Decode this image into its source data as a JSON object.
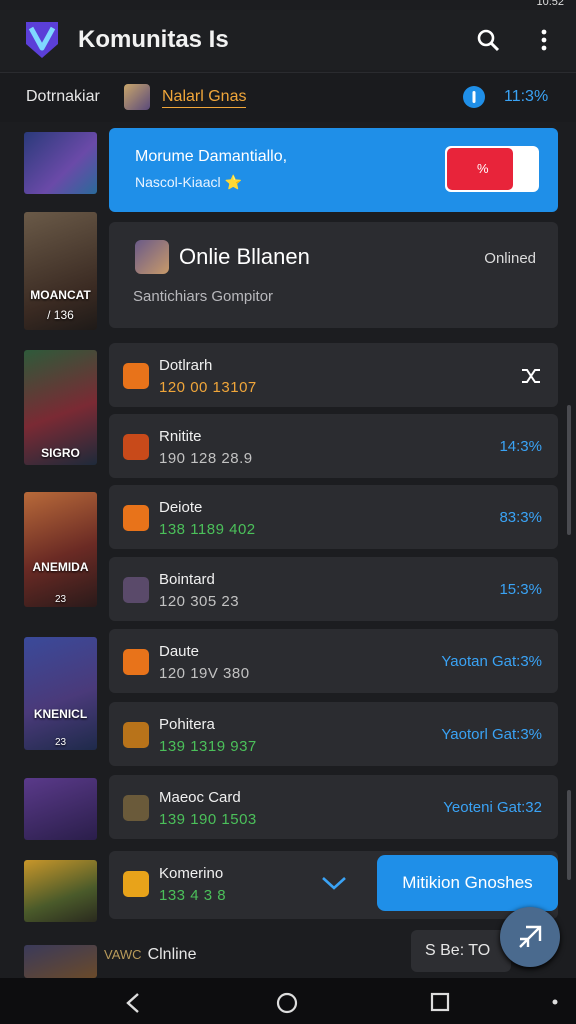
{
  "statusbar": {
    "time": "10:52"
  },
  "header": {
    "title": "Komunitas Is"
  },
  "filter": {
    "label": "Dotrnakiar",
    "selected": "Nalarl Gnas",
    "percent": "11:3%"
  },
  "promo": {
    "title": "Morume Damantiallo,",
    "subtitle": "Nascol-Kiaacl ⭐",
    "toggle_label": "%"
  },
  "online_card": {
    "title": "Onlie Bllanen",
    "status": "Onlined",
    "subtitle": "Santichiars Gompitor"
  },
  "thumbs": [
    {
      "caption": ""
    },
    {
      "caption": "MOANCAT",
      "sub": "/ 136"
    },
    {
      "caption": "SIGRO"
    },
    {
      "caption": "ANEMIDA",
      "sub": "23"
    },
    {
      "caption": "KNENICL",
      "sub": "23"
    },
    {
      "caption": ""
    },
    {
      "caption": ""
    }
  ],
  "rows": [
    {
      "name": "Dotlrarh",
      "meta": "120  00 13107",
      "value": ""
    },
    {
      "name": "Rnitite",
      "meta": "190 128  28.9",
      "value": "14:3%"
    },
    {
      "name": "Deiote",
      "meta": "138  1189  402",
      "value": "83:3%"
    },
    {
      "name": "Bointard",
      "meta": "120  305  23",
      "value": "15:3%"
    },
    {
      "name": "Daute",
      "meta": "120 19V  380",
      "value": "Yaotan Gat:3%"
    },
    {
      "name": "Pohitera",
      "meta": "139 1319  937",
      "value": "Yaotorl Gat:3%"
    },
    {
      "name": "Maeoc Card",
      "meta": "139  190  1503",
      "value": "Yeoteni Gat:32"
    },
    {
      "name": "Komerino",
      "meta": "133 4 3 8",
      "value": ""
    }
  ],
  "bottom": {
    "action_button": "Mitikion Gnoshes",
    "chip": "S Be: TO",
    "last_label": "Clnline",
    "last_prefix": "VAWC"
  }
}
